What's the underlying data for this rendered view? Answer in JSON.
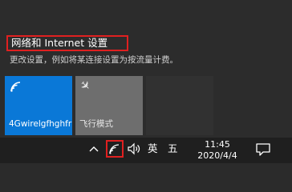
{
  "flyout": {
    "settings_link_label": "网络和 Internet 设置",
    "settings_description": "更改设置，例如将某连接设置为按流量计费。"
  },
  "quick_actions": [
    {
      "label": "4Gwirelgfhghfr",
      "icon": "wifi-icon",
      "state": "on",
      "color": "#0a78d7"
    },
    {
      "label": "飞行模式",
      "icon": "airplane-icon",
      "state": "off",
      "color": "#6e6e6e"
    }
  ],
  "taskbar": {
    "ime_language": "英",
    "ime_mode": "五",
    "time": "11:45",
    "date": "2020/4/4",
    "icons": [
      "chevron-up-icon",
      "network-icon",
      "volume-icon",
      "notification-icon"
    ]
  },
  "colors": {
    "accent": "#0a78d7",
    "highlight_box": "#e02020"
  }
}
